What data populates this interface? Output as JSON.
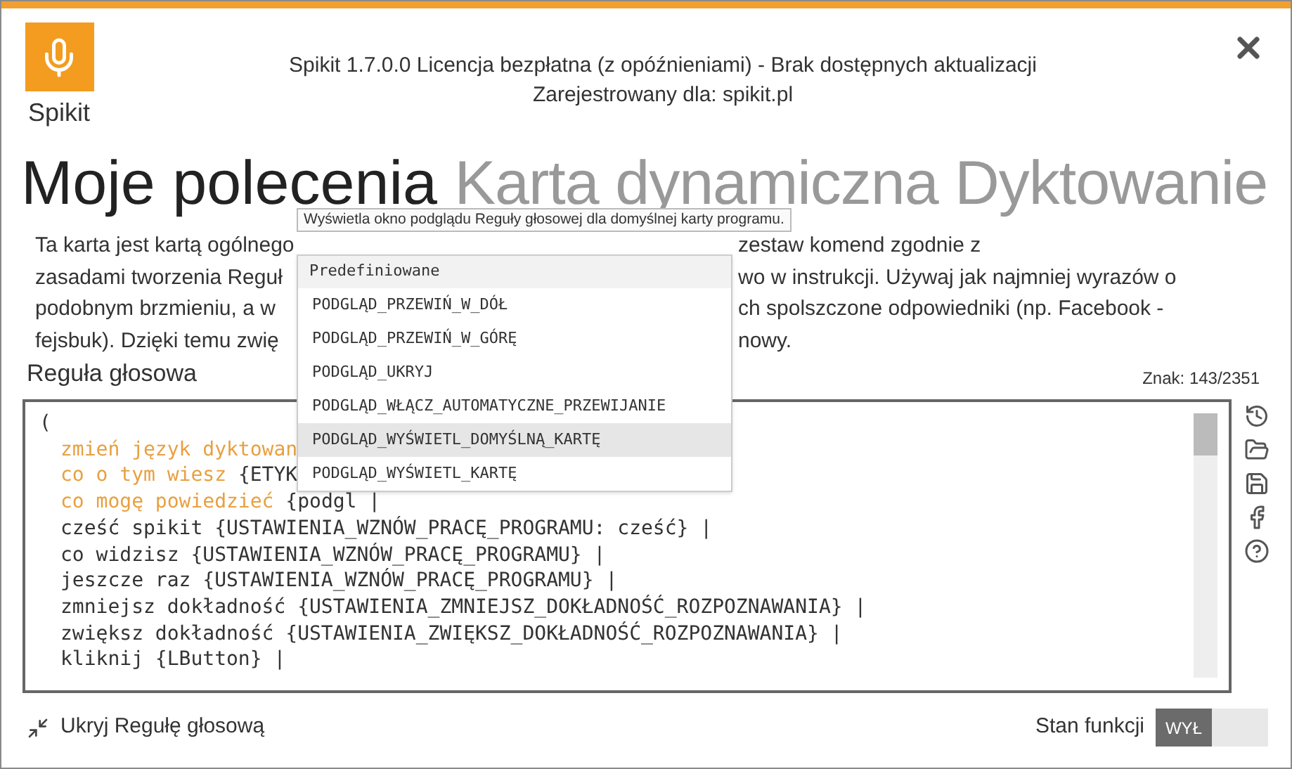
{
  "app": {
    "name": "Spikit",
    "license": "Spikit 1.7.0.0 Licencja bezpłatna (z opóźnieniami) - Brak dostępnych aktualizacji",
    "registered": "Zarejestrowany dla: spikit.pl"
  },
  "heading": {
    "primary": "Moje polecenia",
    "secondary": "Karta dynamiczna Dyktowanie"
  },
  "description_lines": [
    {
      "left": "Ta karta jest kartą ogólnego",
      "right": "zestaw komend zgodnie z"
    },
    {
      "left": "zasadami tworzenia Reguł",
      "right": "wo w instrukcji. Używaj jak najmniej wyrazów o"
    },
    {
      "left": "podobnym brzmieniu, a w",
      "right": "ch spolszczone odpowiedniki (np. Facebook -"
    },
    {
      "left": "fejsbuk). Dzięki temu zwię",
      "right": "nowy."
    }
  ],
  "rule_label": "Reguła głosowa",
  "char_count": "Znak: 143/2351",
  "code_lines": [
    {
      "indent": false,
      "rest": "("
    },
    {
      "indent": true,
      "phrase": "zmień język dyktowan"
    },
    {
      "indent": true,
      "phrase": "co o tym wiesz ",
      "rest": "{ETYK"
    },
    {
      "indent": true,
      "phrase": "co mogę powiedzieć ",
      "rest": "{podgl |"
    },
    {
      "indent": true,
      "rest": "cześć spikit {USTAWIENIA_WZNÓW_PRACĘ_PROGRAMU: cześć} |"
    },
    {
      "indent": true,
      "rest": "co widzisz {USTAWIENIA_WZNÓW_PRACĘ_PROGRAMU} |"
    },
    {
      "indent": true,
      "rest": "jeszcze raz {USTAWIENIA_WZNÓW_PRACĘ_PROGRAMU} |"
    },
    {
      "indent": true,
      "rest": "zmniejsz dokładność {USTAWIENIA_ZMNIEJSZ_DOKŁADNOŚĆ_ROZPOZNAWANIA} |"
    },
    {
      "indent": true,
      "rest": "zwiększ dokładność {USTAWIENIA_ZWIĘKSZ_DOKŁADNOŚĆ_ROZPOZNAWANIA} |"
    },
    {
      "indent": true,
      "rest": "kliknij {LButton} |"
    }
  ],
  "autocomplete": {
    "tooltip": "Wyświetla okno podglądu Reguły głosowej dla domyślnej karty programu.",
    "group": "Predefiniowane",
    "items": [
      {
        "label": "PODGLĄD_PRZEWIŃ_W_DÓŁ",
        "selected": false
      },
      {
        "label": "PODGLĄD_PRZEWIŃ_W_GÓRĘ",
        "selected": false
      },
      {
        "label": "PODGLĄD_UKRYJ",
        "selected": false
      },
      {
        "label": "PODGLĄD_WŁĄCZ_AUTOMATYCZNE_PRZEWIJANIE",
        "selected": false
      },
      {
        "label": "PODGLĄD_WYŚWIETL_DOMYŚLNĄ_KARTĘ",
        "selected": true
      },
      {
        "label": "PODGLĄD_WYŚWIETL_KARTĘ",
        "selected": false
      }
    ]
  },
  "hide_rule": "Ukryj Regułę głosową",
  "function_state": {
    "label": "Stan funkcji",
    "value": "WYŁ",
    "on": false
  }
}
